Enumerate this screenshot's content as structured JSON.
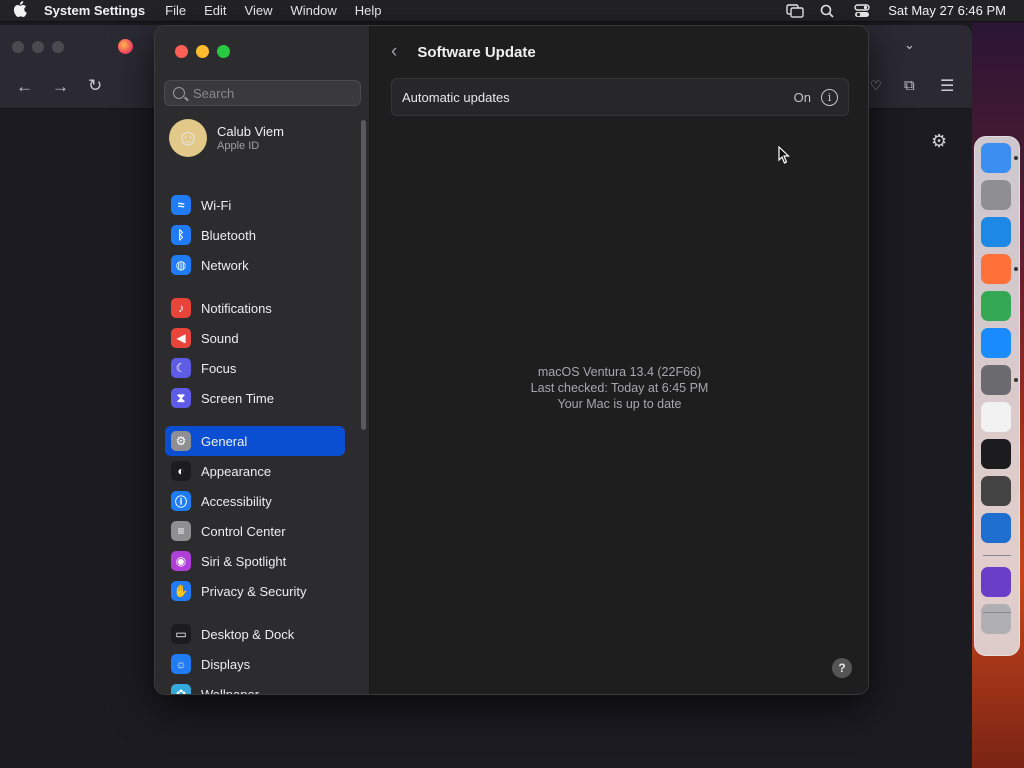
{
  "menubar": {
    "app_name": "System Settings",
    "menus": [
      "File",
      "Edit",
      "View",
      "Window",
      "Help"
    ],
    "clock": "Sat May 27  6:46 PM"
  },
  "window": {
    "search_placeholder": "Search",
    "profile": {
      "name": "Calub Viem",
      "subtitle": "Apple ID"
    },
    "sidebar": [
      {
        "label": "Wi-Fi",
        "icon": "wifi-icon",
        "color": "#1f7cf6"
      },
      {
        "label": "Bluetooth",
        "icon": "bluetooth-icon",
        "color": "#1f7cf6"
      },
      {
        "label": "Network",
        "icon": "globe-icon",
        "color": "#1f7cf6"
      },
      {
        "label": "Notifications",
        "icon": "bell-icon",
        "color": "#e8443a"
      },
      {
        "label": "Sound",
        "icon": "speaker-icon",
        "color": "#e8443a"
      },
      {
        "label": "Focus",
        "icon": "moon-icon",
        "color": "#5e5ce6"
      },
      {
        "label": "Screen Time",
        "icon": "hourglass-icon",
        "color": "#5e5ce6"
      },
      {
        "label": "General",
        "icon": "gear-icon",
        "color": "#8e8e93"
      },
      {
        "label": "Appearance",
        "icon": "appearance-icon",
        "color": "#1c1c1e"
      },
      {
        "label": "Accessibility",
        "icon": "accessibility-icon",
        "color": "#1f7cf6"
      },
      {
        "label": "Control Center",
        "icon": "toggles-icon",
        "color": "#8e8e93"
      },
      {
        "label": "Siri & Spotlight",
        "icon": "siri-icon",
        "color": "#b03fd9"
      },
      {
        "label": "Privacy & Security",
        "icon": "hand-icon",
        "color": "#1f7cf6"
      },
      {
        "label": "Desktop & Dock",
        "icon": "dock-icon",
        "color": "#1c1c1e"
      },
      {
        "label": "Displays",
        "icon": "sun-icon",
        "color": "#1f7cf6"
      },
      {
        "label": "Wallpaper",
        "icon": "flower-icon",
        "color": "#34aadc"
      }
    ],
    "active_item": "General",
    "page_title": "Software Update",
    "automatic_updates": {
      "label": "Automatic updates",
      "value": "On"
    },
    "status": {
      "os": "macOS Ventura 13.4 (22F66)",
      "last_checked": "Last checked: Today at 6:45 PM",
      "message": "Your Mac is up to date"
    },
    "help_label": "?"
  },
  "dock": [
    {
      "name": "finder-app",
      "color": "#3b8ff0"
    },
    {
      "name": "launchpad-app",
      "color": "#8e8e93"
    },
    {
      "name": "safari-app",
      "color": "#1e88e5"
    },
    {
      "name": "firefox-app",
      "color": "#ff7139"
    },
    {
      "name": "chrome-app",
      "color": "#34a853"
    },
    {
      "name": "app-store-app",
      "color": "#1a8cff"
    },
    {
      "name": "system-settings-app",
      "color": "#6b6b70"
    },
    {
      "name": "textedit-app",
      "color": "#f2f2f2"
    },
    {
      "name": "terminal-app",
      "color": "#1c1c1e"
    },
    {
      "name": "garageband-app",
      "color": "#444"
    },
    {
      "name": "vscode-app",
      "color": "#1f6fd0"
    },
    {
      "name": "visual-studio-app",
      "color": "#6a3fc8"
    },
    {
      "name": "trash-app",
      "color": "#b0b0b4"
    }
  ]
}
